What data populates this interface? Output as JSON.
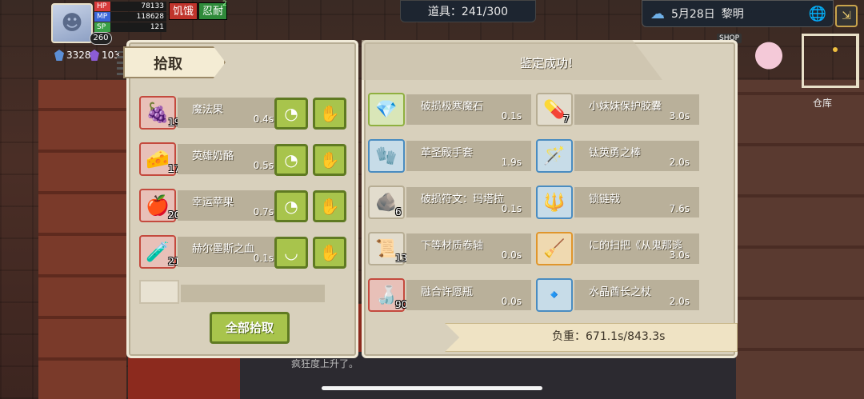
{
  "hud": {
    "hp_label": "HP",
    "hp_value": "78133",
    "mp_label": "MP",
    "mp_value": "118628",
    "sp_label": "SP",
    "sp_value": "121",
    "level": "260",
    "tag_hunger": "饥饿",
    "tag_endure": "忍耐",
    "tag_endure_sup": "2",
    "currency_1": "3328",
    "currency_2": "103"
  },
  "top_bar": {
    "items_label": "道具：241/300",
    "date": "5月28日",
    "time_of_day": "黎明"
  },
  "map": {
    "warehouse_label": "仓库",
    "shop_sign": "SHOP"
  },
  "pickup": {
    "title": "拾取",
    "items": [
      {
        "name": "魔法果",
        "count": "19",
        "weight": "0.4s",
        "icon": "🍇"
      },
      {
        "name": "英雄奶酪",
        "count": "17",
        "weight": "0.5s",
        "icon": "🧀"
      },
      {
        "name": "幸运苹果",
        "count": "20",
        "weight": "0.7s",
        "icon": "🍎"
      },
      {
        "name": "赫尔墨斯之血",
        "count": "21",
        "weight": "0.1s",
        "icon": "🧪"
      }
    ],
    "pickup_all_label": "全部拾取"
  },
  "identify": {
    "title": "鉴定成功!",
    "items": [
      {
        "name": "破损极寒魔石",
        "count": "",
        "weight": "0.1s",
        "icon": "💎"
      },
      {
        "name": "小妹妹保护胶囊",
        "count": "7",
        "weight": "3.0s",
        "icon": "💊"
      },
      {
        "name": "革圣殿手套",
        "count": "",
        "weight": "1.9s",
        "icon": "🧤"
      },
      {
        "name": "钛英勇之棒",
        "count": "",
        "weight": "2.0s",
        "icon": "🪄"
      },
      {
        "name": "破损符文：玛塔拉",
        "count": "6",
        "weight": "0.1s",
        "icon": "🪨"
      },
      {
        "name": "锁链戟",
        "count": "",
        "weight": "7.6s",
        "icon": "🔱"
      },
      {
        "name": "下等材质卷轴",
        "count": "13",
        "weight": "0.0s",
        "icon": "📜"
      },
      {
        "name": "に的扫把《从鬼那逃",
        "count": "",
        "weight": "3.0s",
        "icon": "🧹"
      },
      {
        "name": "融合许愿瓶",
        "count": "90",
        "weight": "0.0s",
        "icon": "🍶"
      },
      {
        "name": "水晶酋长之杖",
        "count": "",
        "weight": "2.0s",
        "icon": "🔹"
      }
    ],
    "weight_label": "负重：671.1s/843.3s"
  },
  "scene": {
    "caption": "疯狂度上升了。"
  }
}
